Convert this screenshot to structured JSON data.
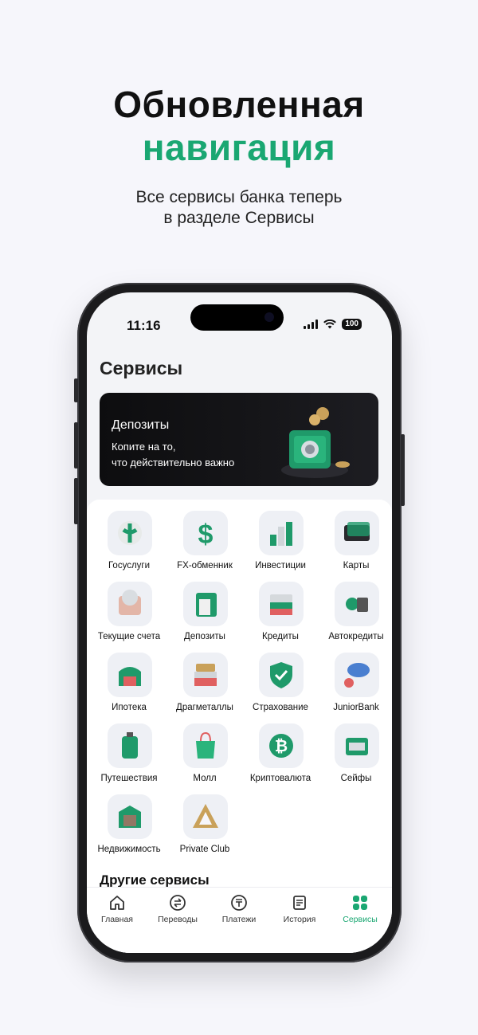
{
  "promo": {
    "title_line1": "Обновленная",
    "title_line2": "навигация",
    "subtitle_line1": "Все сервисы банка теперь",
    "subtitle_line2": "в разделе Сервисы"
  },
  "status_bar": {
    "time": "11:16",
    "battery": "100"
  },
  "screen_title": "Сервисы",
  "banner": {
    "title": "Депозиты",
    "text_line1": "Копите на то,",
    "text_line2": "что действительно важно"
  },
  "services": [
    {
      "label": "Госуслуги",
      "icon": "gosuslugi-icon"
    },
    {
      "label": "FX-обменник",
      "icon": "dollar-icon"
    },
    {
      "label": "Инвестиции",
      "icon": "investments-icon"
    },
    {
      "label": "Карты",
      "icon": "cards-icon"
    },
    {
      "label": "Текущие счета",
      "icon": "accounts-icon"
    },
    {
      "label": "Депозиты",
      "icon": "deposits-icon"
    },
    {
      "label": "Кредиты",
      "icon": "credits-icon"
    },
    {
      "label": "Автокредиты",
      "icon": "car-loan-icon"
    },
    {
      "label": "Ипотека",
      "icon": "mortgage-icon"
    },
    {
      "label": "Драгметаллы",
      "icon": "precious-metals-icon"
    },
    {
      "label": "Страхование",
      "icon": "insurance-shield-icon"
    },
    {
      "label": "JuniorBank",
      "icon": "juniorbank-icon"
    },
    {
      "label": "Путешествия",
      "icon": "suitcase-icon"
    },
    {
      "label": "Молл",
      "icon": "shopping-bag-icon"
    },
    {
      "label": "Криптовалюта",
      "icon": "bitcoin-icon"
    },
    {
      "label": "Сейфы",
      "icon": "safe-box-icon"
    },
    {
      "label": "Недвижимость",
      "icon": "real-estate-icon"
    },
    {
      "label": "Private Club",
      "icon": "private-club-icon"
    }
  ],
  "other_services_title": "Другие сервисы",
  "tabs": [
    {
      "label": "Главная",
      "icon": "home-icon"
    },
    {
      "label": "Переводы",
      "icon": "transfers-icon"
    },
    {
      "label": "Платежи",
      "icon": "payments-icon"
    },
    {
      "label": "История",
      "icon": "history-icon"
    },
    {
      "label": "Сервисы",
      "icon": "services-grid-icon",
      "active": true
    }
  ],
  "colors": {
    "accent": "#1aa772",
    "background": "#f6f6fb",
    "banner": "#111114"
  }
}
